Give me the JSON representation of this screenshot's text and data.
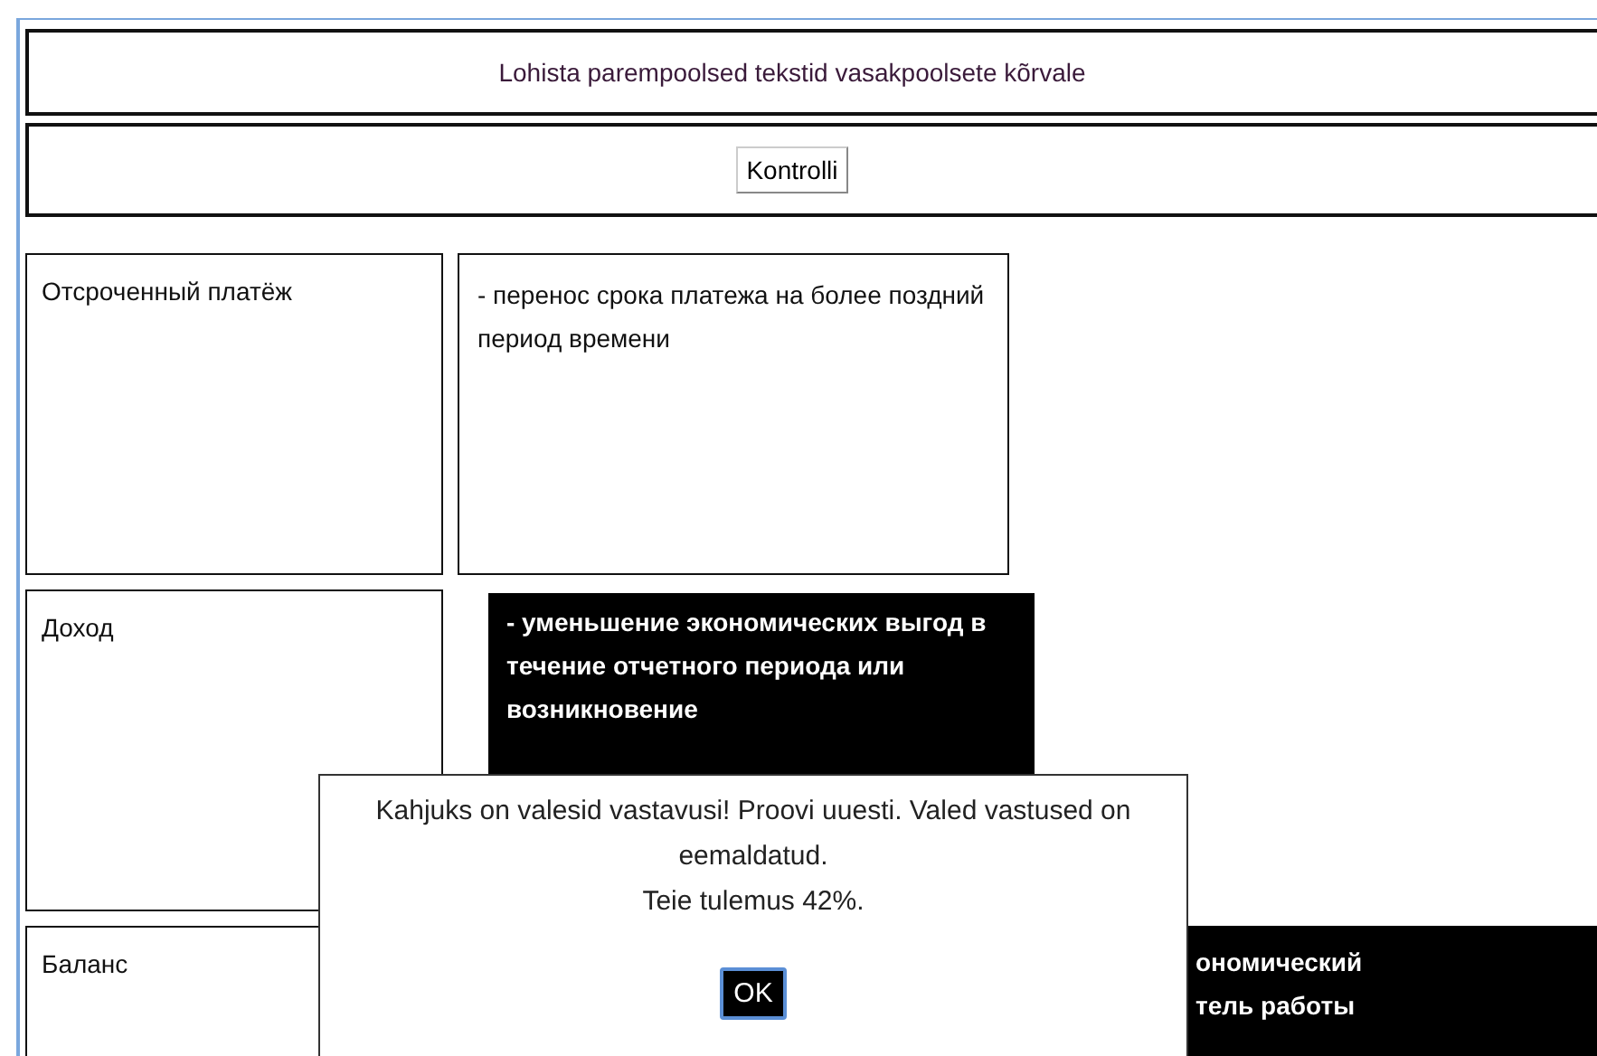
{
  "instruction": "Lohista parempoolsed tekstid vasakpoolsete kõrvale",
  "check_button": "Kontrolli",
  "rows": [
    {
      "term": "Отсроченный платёж",
      "answer": {
        "text": "- перенос срока платежа на более поздний период времени",
        "placed": true
      }
    },
    {
      "term": "Доход",
      "answer": {
        "text": "- уменьшение экономических выгод в течение отчетного периода или возникновение",
        "placed": false
      }
    },
    {
      "term": "Баланс",
      "answer": {
        "text": "ономический\nтель работы",
        "placed": false
      }
    }
  ],
  "dialog": {
    "message": "Kahjuks on valesid vastavusi! Proovi uuesti. Valed vastused on eemaldatud.",
    "result": "Teie tulemus 42%.",
    "button": "OK"
  }
}
